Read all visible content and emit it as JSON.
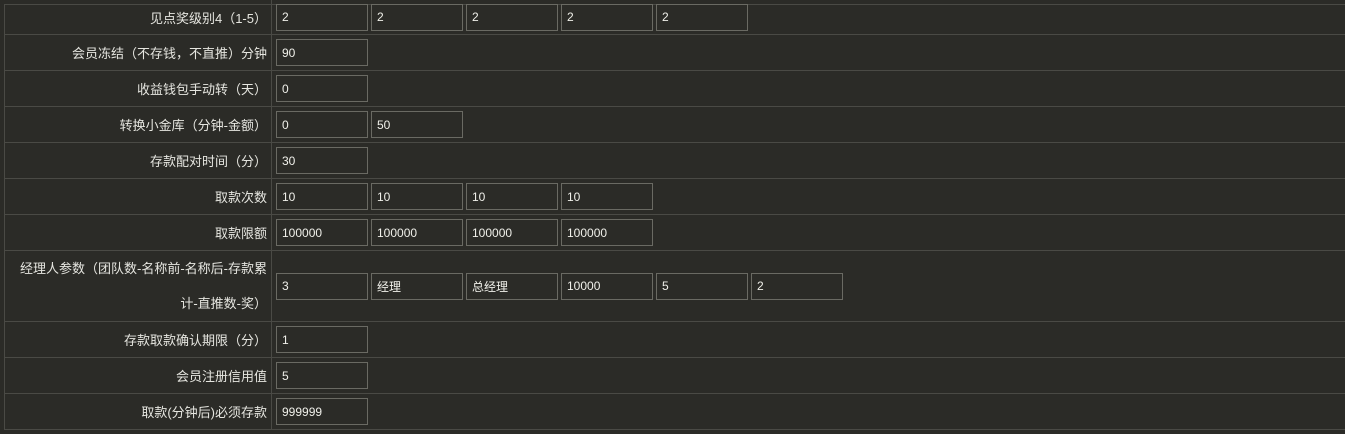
{
  "rows": [
    {
      "label": "见点奖级别4（1-5）",
      "values": [
        "2",
        "2",
        "2",
        "2",
        "2"
      ]
    },
    {
      "label": "会员冻结（不存钱，不直推）分钟",
      "values": [
        "90"
      ]
    },
    {
      "label": "收益钱包手动转（天）",
      "values": [
        "0"
      ]
    },
    {
      "label": "转换小金库（分钟-金额）",
      "values": [
        "0",
        "50"
      ]
    },
    {
      "label": "存款配对时间（分）",
      "values": [
        "30"
      ]
    },
    {
      "label": "取款次数",
      "values": [
        "10",
        "10",
        "10",
        "10"
      ]
    },
    {
      "label": "取款限额",
      "values": [
        "100000",
        "100000",
        "100000",
        "100000"
      ]
    },
    {
      "label": "经理人参数（团队数-名称前-名称后-存款累计-直推数-奖）",
      "values": [
        "3",
        "经理",
        "总经理",
        "10000",
        "5",
        "2"
      ]
    },
    {
      "label": "存款取款确认期限（分）",
      "values": [
        "1"
      ]
    },
    {
      "label": "会员注册信用值",
      "values": [
        "5"
      ]
    },
    {
      "label": "取款(分钟后)必须存款",
      "values": [
        "999999"
      ]
    }
  ]
}
